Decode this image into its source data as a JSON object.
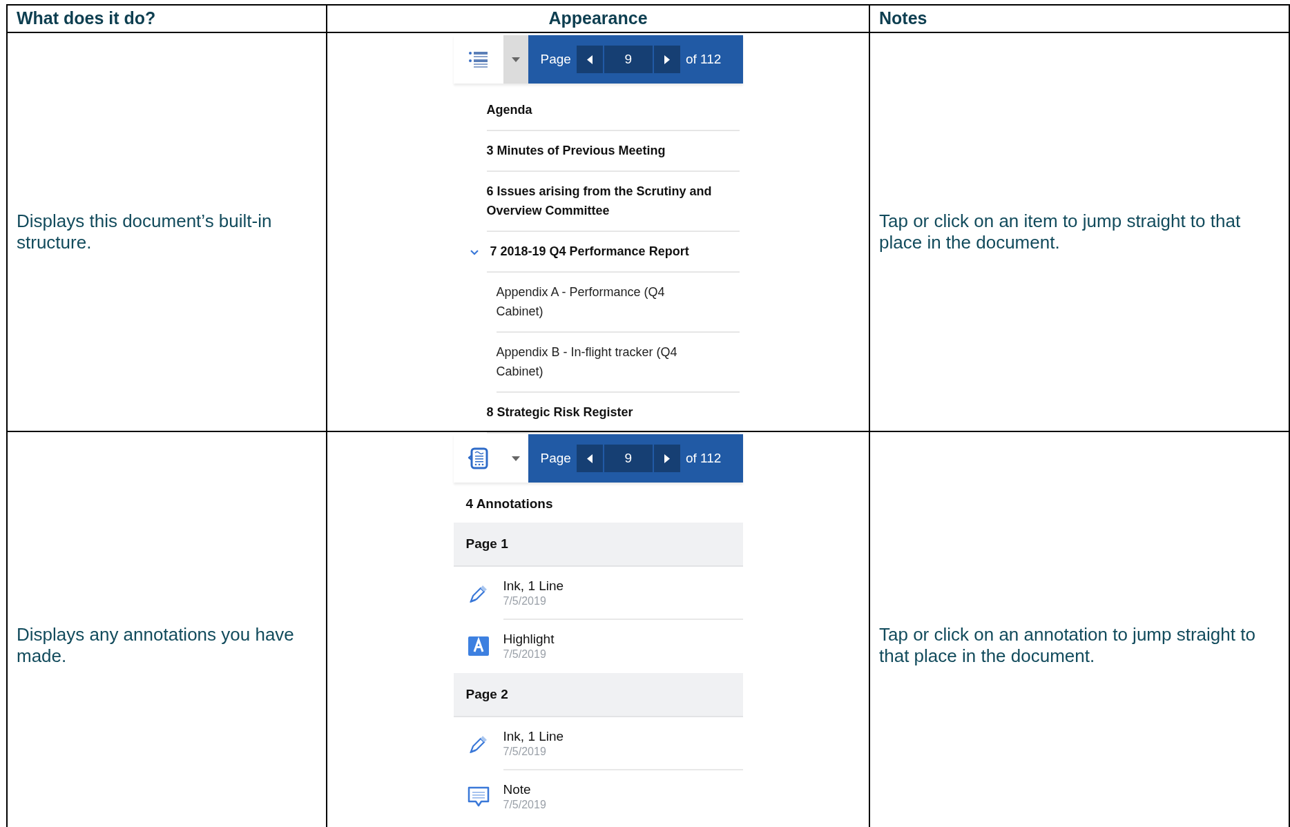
{
  "table": {
    "columns": [
      "What does it do?",
      "Appearance",
      "Notes"
    ],
    "rows": [
      {
        "description": "Displays this document’s built-in structure.",
        "notes": "Tap or click on an item to jump straight to that place in the document.",
        "panel": {
          "kind": "outline",
          "toolbar": {
            "dropdown_highlighted": true,
            "page_label": "Page",
            "page": "9",
            "of_label": "of 112"
          },
          "items": [
            {
              "label": "Agenda"
            },
            {
              "label": "3 Minutes of Previous Meeting"
            },
            {
              "label": "6 Issues arising from the Scrutiny and Overview Committee"
            },
            {
              "label": "7 2018-19 Q4 Performance Report",
              "expanded": true,
              "children": [
                {
                  "label": "Appendix A - Performance (Q4 Cabinet)"
                },
                {
                  "label": "Appendix B - In-flight tracker (Q4 Cabinet)"
                }
              ]
            },
            {
              "label": "8 Strategic Risk Register"
            }
          ]
        }
      },
      {
        "description": "Displays any annotations you have made.",
        "notes": "Tap or click on an annotation to jump straight to that place in the document.",
        "panel": {
          "kind": "annotations",
          "toolbar": {
            "dropdown_highlighted": false,
            "page_label": "Page",
            "page": "9",
            "of_label": "of 112"
          },
          "count": "4 Annotations",
          "groups": [
            {
              "label": "Page 1",
              "items": [
                {
                  "kind": "ink",
                  "title": "Ink, 1 Line",
                  "date": "7/5/2019"
                },
                {
                  "kind": "highlight",
                  "title": "Highlight",
                  "date": "7/5/2019"
                }
              ]
            },
            {
              "label": "Page 2",
              "items": [
                {
                  "kind": "ink",
                  "title": "Ink, 1 Line",
                  "date": "7/5/2019"
                },
                {
                  "kind": "note",
                  "title": "Note",
                  "date": "7/5/2019"
                }
              ]
            }
          ]
        }
      }
    ]
  }
}
